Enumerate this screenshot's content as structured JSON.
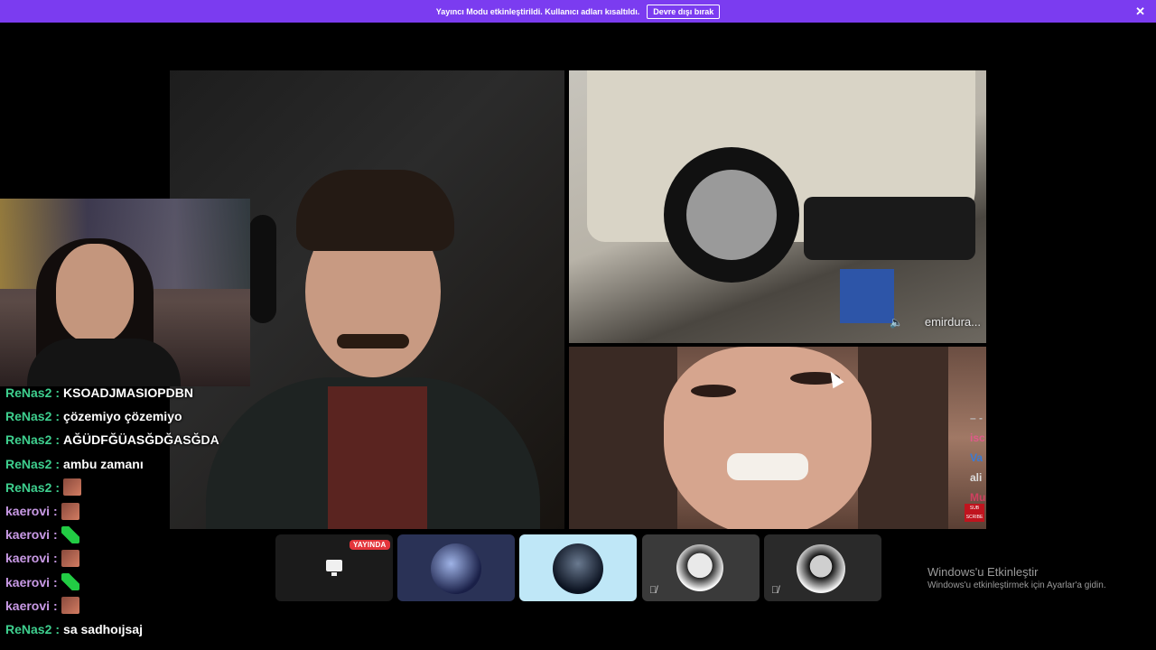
{
  "banner": {
    "message": "Yayıncı Modu etkinleştirildi. Kullanıcı adları kısaltıldı.",
    "button_label": "Devre dışı bırak",
    "close_glyph": "✕"
  },
  "videos": {
    "car_caption": "emirdura...",
    "side_chat": [
      "– -",
      "isc",
      "Va",
      "ali",
      "Mu"
    ],
    "sub_badge": "SUB SCRIBE"
  },
  "chat": [
    {
      "user": "ReNas2",
      "color": "#3ecf8e",
      "message": "KSOADJMASIOPDBN",
      "emote": ""
    },
    {
      "user": "ReNas2",
      "color": "#3ecf8e",
      "message": "çözemiyo çözemiyo",
      "emote": ""
    },
    {
      "user": "ReNas2",
      "color": "#3ecf8e",
      "message": "AĞÜDFĞÜASĞDĞASĞDA",
      "emote": ""
    },
    {
      "user": "ReNas2",
      "color": "#3ecf8e",
      "message": "ambu zamanı",
      "emote": ""
    },
    {
      "user": "ReNas2",
      "color": "#3ecf8e",
      "message": "",
      "emote": "face"
    },
    {
      "user": "kaerovi",
      "color": "#c99ae6",
      "message": "",
      "emote": "face"
    },
    {
      "user": "kaerovi",
      "color": "#c99ae6",
      "message": "",
      "emote": "green"
    },
    {
      "user": "kaerovi",
      "color": "#c99ae6",
      "message": "",
      "emote": "face"
    },
    {
      "user": "kaerovi",
      "color": "#c99ae6",
      "message": "",
      "emote": "green"
    },
    {
      "user": "kaerovi",
      "color": "#c99ae6",
      "message": "",
      "emote": "face"
    },
    {
      "user": "ReNas2",
      "color": "#3ecf8e",
      "message": "sa sadhoıjsaj",
      "emote": ""
    }
  ],
  "participants": {
    "live_badge": "YAYINDA",
    "mute_glyph": "🎙̸"
  },
  "watermark": {
    "title": "Windows'u Etkinleştir",
    "subtitle": "Windows'u etkinleştirmek için Ayarlar'a gidin."
  },
  "colors": {
    "banner": "#7b3cf0",
    "live_badge": "#e4353b",
    "chat_user_renas": "#3ecf8e",
    "chat_user_kaerovi": "#c99ae6"
  }
}
